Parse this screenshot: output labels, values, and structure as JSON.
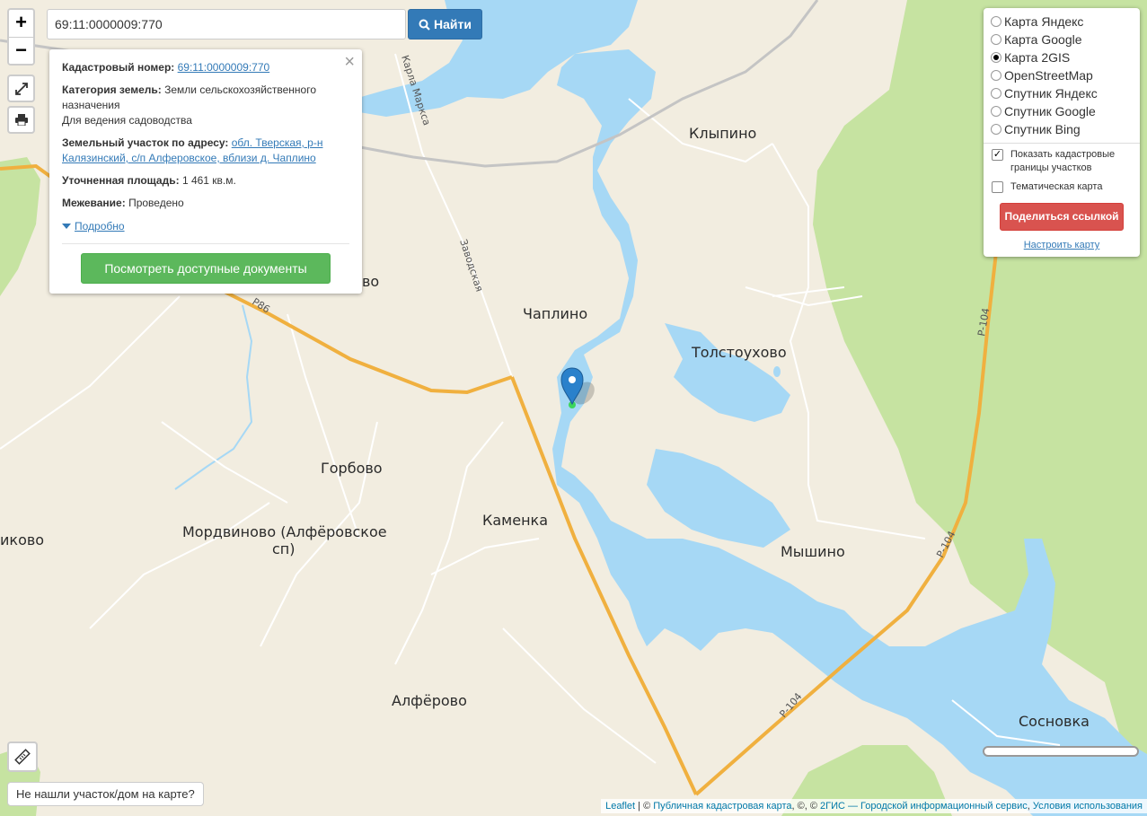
{
  "search": {
    "value": "69:11:0000009:770",
    "button_label": "Найти"
  },
  "zoom": {
    "in": "+",
    "out": "−"
  },
  "info_card": {
    "cadastral_label": "Кадастровый номер:",
    "cadastral_value": "69:11:0000009:770",
    "category_label": "Категория земель:",
    "category_value": "Земли сельскохозяйственного назначения",
    "usage": "Для ведения садоводства",
    "address_label": "Земельный участок по адресу:",
    "address_value": "обл. Тверская, р-н Калязинский, с/п Алферовское, вблизи д. Чаплино",
    "area_label": "Уточненная площадь:",
    "area_value": "1 461 кв.м.",
    "survey_label": "Межевание:",
    "survey_value": "Проведено",
    "more_link": "Подробно",
    "docs_button": "Посмотреть доступные документы",
    "close_glyph": "×"
  },
  "layers": {
    "options": [
      {
        "label": "Карта Яндекс",
        "selected": false
      },
      {
        "label": "Карта Google",
        "selected": false
      },
      {
        "label": "Карта 2GIS",
        "selected": true
      },
      {
        "label": "OpenStreetMap",
        "selected": false
      },
      {
        "label": "Спутник Яндекс",
        "selected": false
      },
      {
        "label": "Спутник Google",
        "selected": false
      },
      {
        "label": "Спутник Bing",
        "selected": false
      }
    ],
    "show_borders_label": "Показать кадастровые границы участков",
    "show_borders_checked": true,
    "thematic_label": "Тематическая карта",
    "thematic_checked": false,
    "share_button": "Поделиться ссылкой",
    "configure_link": "Настроить карту"
  },
  "map": {
    "places": {
      "klypino": "Клыпино",
      "chaplino": "Чаплино",
      "tolstoukhovo": "Толстоухово",
      "gorbovo": "Горбово",
      "kamenka": "Каменка",
      "mordvinovo_1": "Мордвиново (Алфёровское",
      "mordvinovo_2": "сп)",
      "myshino": "Мышино",
      "alferovo": "Алфёрово",
      "sosnovka": "Сосновка",
      "ikovo": "иково",
      "vo_partial": "во"
    },
    "roads": {
      "karla_marksa": "Карла Маркса",
      "zavodskaya": "Заводская",
      "r86": "Р86",
      "r104_a": "Р-104",
      "r104_b": "Р-104",
      "r104_c": "Р-104"
    },
    "colors": {
      "land": "#f2ede0",
      "water": "#a6d8f5",
      "forest": "#c6e3a1",
      "highway": "#f0b03f",
      "marker": "#2a81cb"
    }
  },
  "not_found_button": "Не нашли участок/дом на карте?",
  "attribution": {
    "leaflet": "Leaflet",
    "sep1": " | © ",
    "pkk": "Публичная кадастровая карта",
    "sep2": ", ©, © ",
    "twogis": "2ГИС — Городской информационный сервис",
    "sep3": ", ",
    "terms": "Условия использования"
  }
}
